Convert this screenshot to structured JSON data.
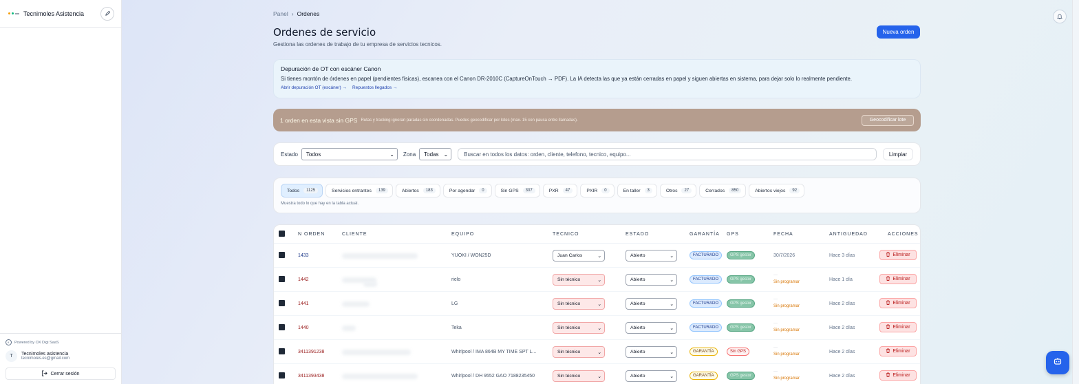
{
  "app": {
    "name": "Tecnimoles Asistencia",
    "powered_by": "Powered by OX Digi SaaS",
    "user_initial": "T",
    "user_name": "Tecnimoles asistencia",
    "user_email": "tecnimoles.es@gmail.com",
    "logout_label": "Cerrar sesión"
  },
  "breadcrumb": {
    "root": "Panel",
    "current": "Ordenes"
  },
  "page": {
    "title": "Ordenes de servicio",
    "subtitle": "Gestiona las ordenes de trabajo de tu empresa de servicios tecnicos.",
    "new_order": "Nueva orden"
  },
  "info_card": {
    "title": "Depuración de OT con escáner Canon",
    "desc": "Si tienes montón de órdenes en papel (pendientes físicas), escanea con el Canon DR-2010C (CaptureOnTouch → PDF). La IA detecta las que ya están cerradas en papel y siguen abiertas en sistema, para dejar solo lo realmente pendiente.",
    "link1": "Abrir depuración OT (escáner) →",
    "link2": "Repuestos llegados →"
  },
  "gps_banner": {
    "title": "1 orden en esta vista sin GPS",
    "desc": "Rutas y tracking ignoran paradas sin coordenadas. Puedes geocodificar por lotes (max. 15 con pausa entre llamadas).",
    "button": "Geocodificar lote"
  },
  "filters": {
    "estado_label": "Estado",
    "estado_value": "Todos",
    "zona_label": "Zona",
    "zona_value": "Todas",
    "search_placeholder": "Buscar en todos los datos: orden, cliente, telefono, tecnico, equipo...",
    "clear": "Limpiar"
  },
  "tabs": [
    {
      "label": "Todos",
      "count": "1125"
    },
    {
      "label": "Servicios entrantes",
      "count": "139"
    },
    {
      "label": "Abiertos",
      "count": "183"
    },
    {
      "label": "Por agendar",
      "count": "0"
    },
    {
      "label": "Sin GPS",
      "count": "307"
    },
    {
      "label": "PXR",
      "count": "47"
    },
    {
      "label": "PXIR",
      "count": "0"
    },
    {
      "label": "En taller",
      "count": "3"
    },
    {
      "label": "Otros",
      "count": "27"
    },
    {
      "label": "Cerrados",
      "count": "850"
    },
    {
      "label": "Abiertos viejos",
      "count": "92"
    }
  ],
  "tabs_note": "Muestra todo lo que hay en la tabla actual.",
  "table": {
    "headers": {
      "orden": "N ORDEN",
      "cliente": "CLIENTE",
      "equipo": "EQUIPO",
      "tecnico": "TECNICO",
      "estado": "ESTADO",
      "garantia": "GARANTÍA",
      "gps": "GPS",
      "fecha": "FECHA",
      "antiguedad": "ANTIGUEDAD",
      "acciones": "ACCIONES"
    },
    "delete_label": "Eliminar",
    "rows": [
      {
        "orden": "1433",
        "equipo": "YUOKI / WON25D",
        "tecnico": "Juan Carlos",
        "estado": "Abierto",
        "garantia": "FACTURADO",
        "gps": "GPS gestor",
        "fecha": "30/7/2026",
        "fecha_dash": "",
        "antiguedad": "Hace 3 días"
      },
      {
        "orden": "1442",
        "equipo": "rielo",
        "tecnico": "Sin técnico",
        "estado": "Abierto",
        "garantia": "FACTURADO",
        "gps": "GPS gestor",
        "fecha": "Sin programar",
        "fecha_dash": "—",
        "antiguedad": "Hace 1 día"
      },
      {
        "orden": "1441",
        "equipo": "LG",
        "tecnico": "Sin técnico",
        "estado": "Abierto",
        "garantia": "FACTURADO",
        "gps": "GPS gestor",
        "fecha": "Sin programar",
        "fecha_dash": "—",
        "antiguedad": "Hace 2 días"
      },
      {
        "orden": "1440",
        "equipo": "Teka",
        "tecnico": "Sin técnico",
        "estado": "Abierto",
        "garantia": "FACTURADO",
        "gps": "GPS gestor",
        "fecha": "Sin programar",
        "fecha_dash": "—",
        "antiguedad": "Hace 2 días"
      },
      {
        "orden": "3411391238",
        "equipo": "Whirlpool / IMA 864B MY TIME SPT L...",
        "tecnico": "Sin técnico",
        "estado": "Abierto",
        "garantia": "GARANTÍA",
        "gps": "Sin GPS",
        "fecha": "Sin programar",
        "fecha_dash": "—",
        "antiguedad": "Hace 2 días"
      },
      {
        "orden": "3411393438",
        "equipo": "Whirlpool / DH 9552 GAO 7188235450",
        "tecnico": "Sin técnico",
        "estado": "Abierto",
        "garantia": "GARANTÍA",
        "gps": "GPS gestor",
        "fecha": "Sin programar",
        "fecha_dash": "—",
        "antiguedad": "Hace 2 días"
      }
    ]
  }
}
